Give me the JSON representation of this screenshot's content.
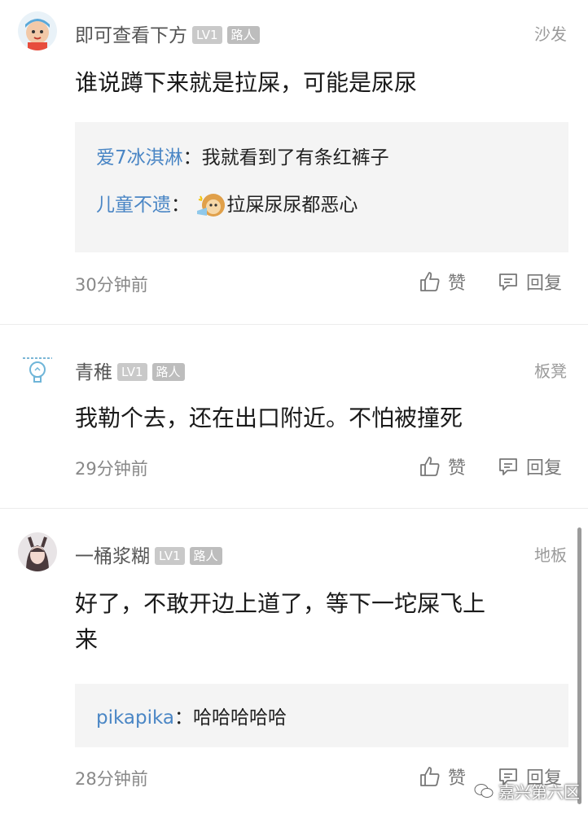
{
  "comments": [
    {
      "username": "即可查看下方",
      "level": "LV1",
      "role": "路人",
      "floor": "沙发",
      "content": "谁说蹲下来就是拉屎，可能是尿尿",
      "replies": [
        {
          "user": "爱7冰淇淋",
          "sep": "：",
          "text": "我就看到了有条红裤子"
        },
        {
          "user": "儿童不遗",
          "sep": "：",
          "text": "拉屎尿尿都恶心"
        }
      ],
      "time": "30分钟前",
      "like_label": "赞",
      "reply_label": "回复"
    },
    {
      "username": "青稚",
      "level": "LV1",
      "role": "路人",
      "floor": "板凳",
      "content": "我勒个去，还在出口附近。不怕被撞死",
      "time": "29分钟前",
      "like_label": "赞",
      "reply_label": "回复"
    },
    {
      "username": "一桶浆糊",
      "level": "LV1",
      "role": "路人",
      "floor": "地板",
      "content_line1": "好了，不敢开边上道了，等下一坨屎飞上",
      "content_line2": "来",
      "replies": [
        {
          "user": "pikapika",
          "sep": "：",
          "text": "哈哈哈哈哈"
        }
      ],
      "time": "28分钟前",
      "like_label": "赞",
      "reply_label": "回复"
    }
  ],
  "watermark": "嘉兴第六区",
  "colors": {
    "reply_user": "#4a86c5",
    "badge": "#c9c9c9",
    "reply_bg": "#f4f4f4"
  }
}
